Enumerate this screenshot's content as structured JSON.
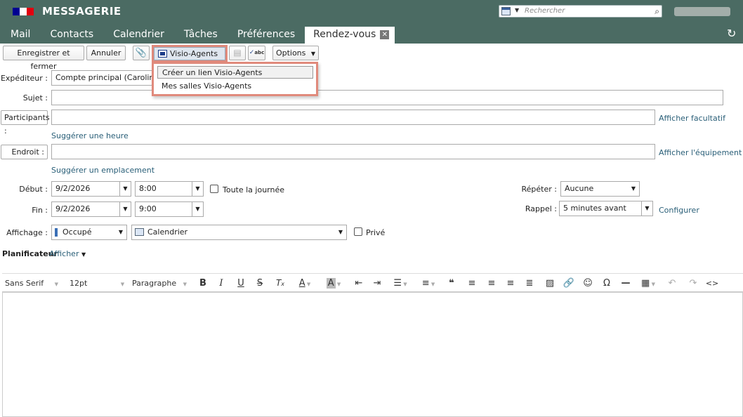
{
  "header": {
    "app_title": "MESSAGERIE",
    "flag_colors": [
      "#000091",
      "#ffffff",
      "#e1000f"
    ],
    "search_placeholder": "Rechercher",
    "search_icon": "magnifier-icon",
    "refresh_icon": "refresh-icon"
  },
  "tabs": [
    "Mail",
    "Contacts",
    "Calendrier",
    "Tâches",
    "Préférences",
    "Rendez-vous"
  ],
  "toolbar": {
    "save_close": "Enregistrer et fermer",
    "cancel": "Annuler",
    "visio": "Visio-Agents",
    "options": "Options"
  },
  "visio_menu": {
    "items": [
      "Créer un lien Visio-Agents",
      "Mes salles Visio-Agents"
    ]
  },
  "form": {
    "sender_label": "Expéditeur :",
    "sender_value": "Compte principal (Caroline Jo",
    "subject_label": "Sujet :",
    "participants_label": "Participants :",
    "show_optional": "Afficher facultatif",
    "suggest_time": "Suggérer une heure",
    "location_label": "Endroit :",
    "show_equipment": "Afficher l'équipement",
    "suggest_location": "Suggérer un emplacement",
    "start_label": "Début :",
    "start_date": "9/2/2026",
    "start_time": "8:00",
    "all_day": "Toute la journée",
    "end_label": "Fin :",
    "end_date": "9/2/2026",
    "end_time": "9:00",
    "repeat_label": "Répéter :",
    "repeat_value": "Aucune",
    "reminder_label": "Rappel :",
    "reminder_value": "5 minutes avant",
    "configure": "Configurer",
    "display_label": "Affichage :",
    "display_value": "Occupé",
    "calendar_value": "Calendrier",
    "private": "Privé",
    "planner_label": "Planificateur",
    "planner_show": "Afficher"
  },
  "editor": {
    "font": "Sans Serif",
    "size": "12pt",
    "format": "Paragraphe"
  },
  "colors": {
    "header_bg": "#4b6b63",
    "highlight_border": "#e08a7c",
    "link": "#2a5f78"
  }
}
